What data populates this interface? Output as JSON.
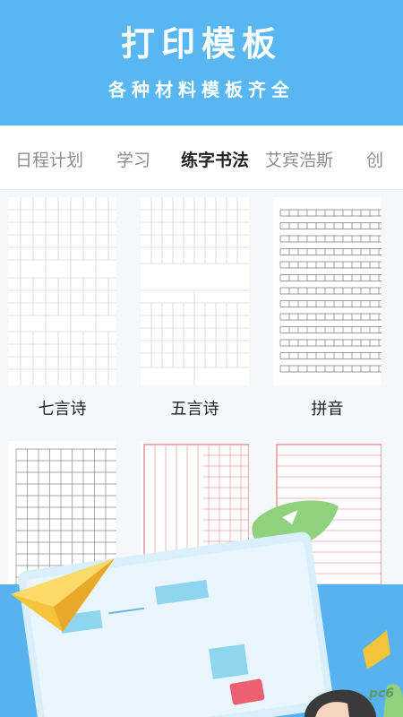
{
  "header": {
    "title": "打印模板",
    "subtitle": "各种材料模板齐全"
  },
  "tabs": [
    {
      "label": "日程计划",
      "active": false
    },
    {
      "label": "学习",
      "active": false
    },
    {
      "label": "练字书法",
      "active": true
    },
    {
      "label": "艾宾浩斯",
      "active": false
    },
    {
      "label": "创",
      "active": false
    }
  ],
  "templates": [
    {
      "label": "七言诗",
      "grid_color": "#b6b6b6"
    },
    {
      "label": "五言诗",
      "grid_color": "#b6b6b6"
    },
    {
      "label": "拼音",
      "grid_color": "#777777"
    },
    {
      "label": "",
      "grid_color": "#888888"
    },
    {
      "label": "",
      "grid_color": "#e07a7a"
    },
    {
      "label": "",
      "grid_color": "#e07a7a"
    }
  ],
  "colors": {
    "header_bg": "#58b6f3",
    "banner_blue": "#56b3f0",
    "accent_green": "#8fd17d",
    "accent_yellow": "#f6c43b"
  },
  "watermark": "pc6"
}
